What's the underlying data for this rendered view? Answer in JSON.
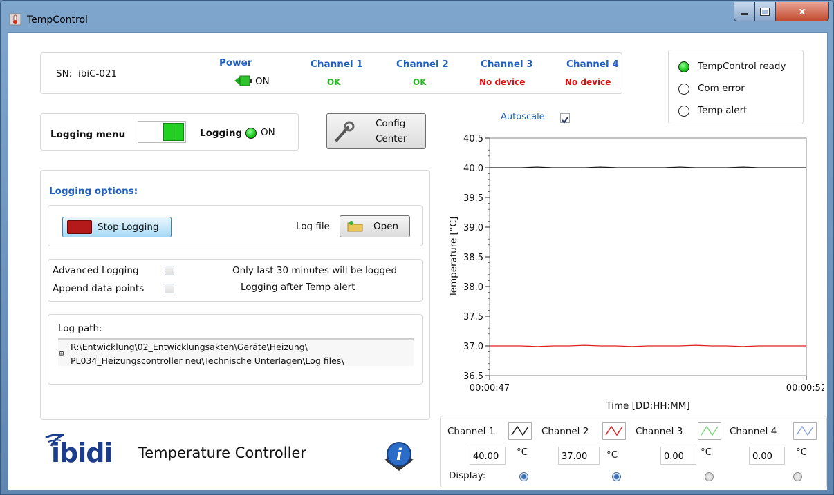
{
  "window": {
    "title": "TempControl",
    "close_label": "x"
  },
  "status_panel": {
    "sn_label": "SN:",
    "sn_value": "ibiC-021",
    "power": {
      "label": "Power",
      "state": "ON"
    },
    "channels": [
      {
        "label": "Channel 1",
        "status": "OK"
      },
      {
        "label": "Channel 2",
        "status": "OK"
      },
      {
        "label": "Channel 3",
        "status": "No device"
      },
      {
        "label": "Channel 4",
        "status": "No device"
      }
    ]
  },
  "indicators": [
    {
      "label": "TempControl ready",
      "active": true
    },
    {
      "label": "Com error",
      "active": false
    },
    {
      "label": "Temp alert",
      "active": false
    }
  ],
  "logging_menu": {
    "label": "Logging menu",
    "logging_label": "Logging",
    "logging_state": "ON"
  },
  "config_button": {
    "line1": "Config",
    "line2": "Center"
  },
  "logging_options": {
    "title": "Logging options:",
    "stop_button": "Stop Logging",
    "log_file_label": "Log file",
    "open_button": "Open",
    "advanced_logging": "Advanced Logging",
    "append_data_points": "Append data points",
    "note1": "Only last 30 minutes will be logged",
    "note2": "Logging after Temp alert",
    "log_path_label": "Log path:",
    "log_path_line1": "R:\\Entwicklung\\02_Entwicklungsakten\\Geräte\\Heizung\\",
    "log_path_line2": "PL034_Heizungscontroller neu\\Technische Unterlagen\\Log files\\"
  },
  "branding": {
    "logo": "ibidi",
    "product": "Temperature Controller"
  },
  "autoscale": {
    "label": "Autoscale",
    "checked": true
  },
  "chart_data": {
    "type": "line",
    "xlabel": "Time [DD:HH:MM]",
    "ylabel": "Temperature [°C]",
    "ylim": [
      36.5,
      40.5
    ],
    "yticks": [
      "40.5",
      "40.0",
      "39.5",
      "39.0",
      "38.5",
      "38.0",
      "37.5",
      "37.0",
      "36.5"
    ],
    "xticks": [
      "00:00:47",
      "00:00:52"
    ],
    "grid": false,
    "series": [
      {
        "name": "Channel 1",
        "color": "#1a1a1a",
        "y": [
          40.0,
          40.0,
          40.0,
          40.01,
          40.0,
          40.0,
          40.0,
          40.01,
          40.0,
          40.0,
          40.0,
          40.0,
          40.01,
          40.0,
          40.0,
          40.0,
          40.01,
          40.0,
          40.0,
          40.0,
          40.0
        ]
      },
      {
        "name": "Channel 2",
        "color": "#e02020",
        "y": [
          37.0,
          37.0,
          37.0,
          36.99,
          37.0,
          37.0,
          37.01,
          37.0,
          37.0,
          36.99,
          37.0,
          37.0,
          37.0,
          37.01,
          37.0,
          37.0,
          36.99,
          37.0,
          37.0,
          37.0,
          37.0
        ]
      }
    ]
  },
  "channel_controls": {
    "display_label": "Display:",
    "unit": "°C",
    "channels": [
      {
        "label": "Channel 1",
        "value": "40.00",
        "display": true,
        "color": "#1a1a1a"
      },
      {
        "label": "Channel 2",
        "value": "37.00",
        "display": true,
        "color": "#e02020"
      },
      {
        "label": "Channel 3",
        "value": "0.00",
        "display": false,
        "color": "#7fd67f"
      },
      {
        "label": "Channel 4",
        "value": "0.00",
        "display": false,
        "color": "#8fa8d8"
      }
    ]
  }
}
